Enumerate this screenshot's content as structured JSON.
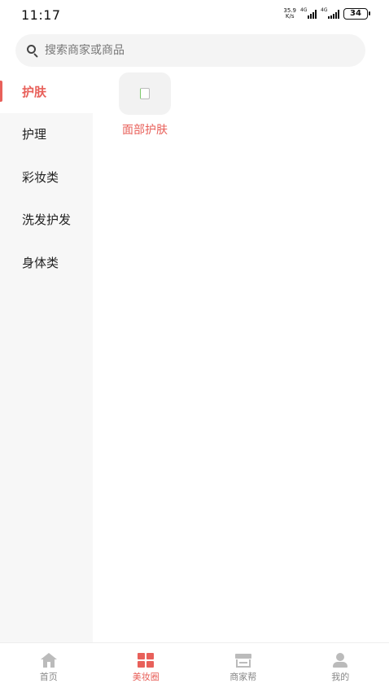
{
  "status_bar": {
    "time": "11:17",
    "net_speed_value": "35.9",
    "net_speed_unit": "K/s",
    "signal_1_tag": "4G",
    "signal_2_tag": "4G",
    "battery": "34"
  },
  "search": {
    "placeholder": "搜索商家或商品"
  },
  "sidebar": {
    "items": [
      {
        "label": "护肤",
        "active": true
      },
      {
        "label": "护理",
        "active": false
      },
      {
        "label": "彩妆类",
        "active": false
      },
      {
        "label": "洗发护发",
        "active": false
      },
      {
        "label": "身体类",
        "active": false
      }
    ]
  },
  "content": {
    "categories": [
      {
        "label": "面部护肤",
        "icon": "product-thumbnail"
      }
    ]
  },
  "tabbar": {
    "tabs": [
      {
        "label": "首页",
        "icon": "home-icon",
        "active": false
      },
      {
        "label": "美妆圈",
        "icon": "grid-icon",
        "active": true
      },
      {
        "label": "商家帮",
        "icon": "shop-icon",
        "active": false
      },
      {
        "label": "我的",
        "icon": "user-icon",
        "active": false
      }
    ]
  },
  "colors": {
    "accent": "#e8605a",
    "sidebar_bg": "#f7f7f7",
    "inactive_icon": "#bbbbbb"
  }
}
